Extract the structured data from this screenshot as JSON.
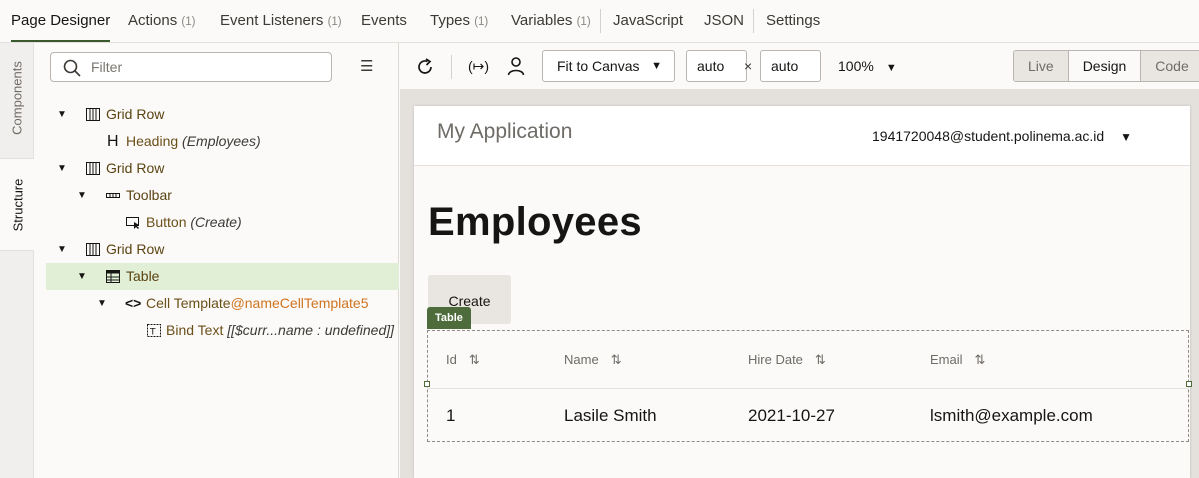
{
  "top_tabs": [
    {
      "label": "Page Designer",
      "count": ""
    },
    {
      "label": "Actions",
      "count": "(1)"
    },
    {
      "label": "Event Listeners",
      "count": "(1)"
    },
    {
      "label": "Events",
      "count": ""
    },
    {
      "label": "Types",
      "count": "(1)"
    },
    {
      "label": "Variables",
      "count": "(1)"
    },
    {
      "label": "JavaScript",
      "count": ""
    },
    {
      "label": "JSON",
      "count": ""
    },
    {
      "label": "Settings",
      "count": ""
    }
  ],
  "side_tabs": {
    "components": "Components",
    "structure": "Structure"
  },
  "filter": {
    "placeholder": "Filter"
  },
  "tree": [
    {
      "name": "Grid Row",
      "sub": ""
    },
    {
      "name": "Heading",
      "sub": "(Employees)"
    },
    {
      "name": "Grid Row",
      "sub": ""
    },
    {
      "name": "Toolbar",
      "sub": ""
    },
    {
      "name": "Button",
      "sub": "(Create)"
    },
    {
      "name": "Grid Row",
      "sub": ""
    },
    {
      "name": "Table",
      "sub": ""
    },
    {
      "name": "Cell Template",
      "ref": "@nameCellTemplate5"
    },
    {
      "name": "Bind Text",
      "sub": "[[$curr...name : undefined]]"
    }
  ],
  "toolbar": {
    "fit": "Fit to Canvas",
    "width": "auto",
    "times": "×",
    "height": "auto",
    "zoom": "100%",
    "modes": [
      "Live",
      "Design",
      "Code"
    ],
    "active_mode": "Design"
  },
  "app": {
    "title": "My Application",
    "user": "1941720048@student.polinema.ac.id",
    "heading": "Employees",
    "create_label": "Create",
    "table_tag": "Table",
    "columns": [
      "Id",
      "Name",
      "Hire Date",
      "Email"
    ],
    "rows": [
      [
        "1",
        "Lasile Smith",
        "2021-10-27",
        "lsmith@example.com"
      ]
    ]
  },
  "colors": {
    "accent": "#3a5a2e",
    "tag_bg": "#4e6b3b",
    "selection": "#e1efd7",
    "ref": "#d0731e"
  }
}
